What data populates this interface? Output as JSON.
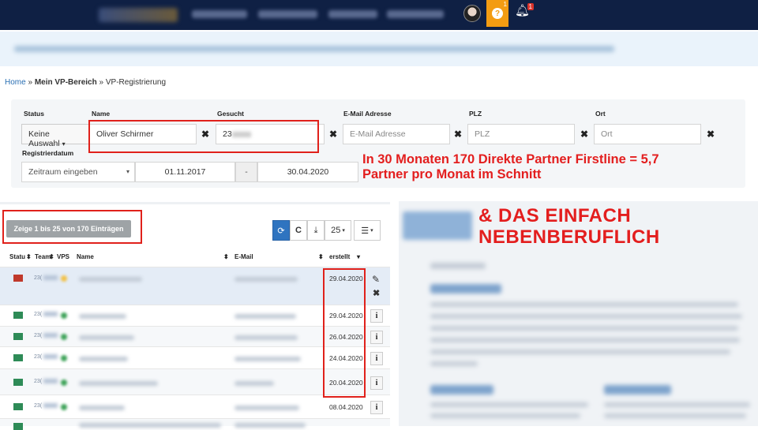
{
  "header": {
    "help_badge": "1",
    "notification_badge": "1"
  },
  "breadcrumb": {
    "home": "Home",
    "sep1": "»",
    "section": "Mein VP-Bereich",
    "sep2": "»",
    "current": "VP-Registrierung"
  },
  "filters": {
    "status_label": "Status",
    "status_value": "Keine Auswahl",
    "name_label": "Name",
    "name_value": "Oliver Schirmer",
    "gesucht_label": "Gesucht",
    "gesucht_value": "23",
    "email_label": "E-Mail Adresse",
    "email_placeholder": "E-Mail Adresse",
    "plz_label": "PLZ",
    "plz_placeholder": "PLZ",
    "ort_label": "Ort",
    "ort_placeholder": "Ort",
    "reg_label": "Registrierdatum",
    "range_placeholder": "Zeitraum eingeben",
    "date_from": "01.11.2017",
    "date_sep": "-",
    "date_to": "30.04.2020",
    "clear": "✖"
  },
  "annotations": {
    "line1": "In 30 Monaten 170 Direkte Partner Firstline = 5,7",
    "line2": "Partner pro Monat im Schnitt",
    "big1": "& DAS EINFACH",
    "big2": "NEBENBERUFLICH"
  },
  "table": {
    "count_label": "Zeige 1 bis 25 von 170 Einträgen",
    "page_size": "25",
    "columns": {
      "status": "Statu",
      "team": "Team",
      "vps": "VPS",
      "name": "Name",
      "email": "E-Mail",
      "created": "erstellt"
    },
    "rows": [
      {
        "status": "red",
        "id": "23(",
        "date": "29.04.2020",
        "vps": "#f2c24a"
      },
      {
        "status": "green",
        "id": "23(",
        "date": "29.04.2020",
        "vps": "#3fa35a"
      },
      {
        "status": "green",
        "id": "23(",
        "date": "26.04.2020",
        "vps": "#3fa35a"
      },
      {
        "status": "green",
        "id": "23(",
        "date": "24.04.2020",
        "vps": "#3fa35a"
      },
      {
        "status": "green",
        "id": "23(",
        "date": "20.04.2020",
        "vps": "#3fa35a"
      },
      {
        "status": "green",
        "id": "23(",
        "date": "08.04.2020",
        "vps": "#3fa35a"
      }
    ]
  },
  "colors": {
    "navbar": "#0f2044",
    "accent": "#f39c12",
    "primary": "#2f74c0",
    "annotation": "#e31e1e"
  }
}
